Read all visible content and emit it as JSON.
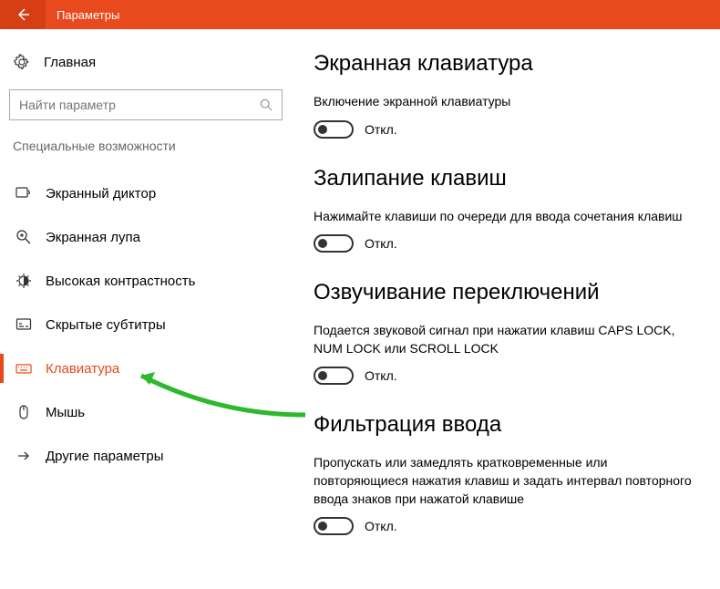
{
  "header": {
    "title": "Параметры"
  },
  "sidebar": {
    "home": "Главная",
    "search_placeholder": "Найти параметр",
    "section": "Специальные возможности",
    "items": [
      {
        "label": "Экранный диктор"
      },
      {
        "label": "Экранная лупа"
      },
      {
        "label": "Высокая контрастность"
      },
      {
        "label": "Скрытые субтитры"
      },
      {
        "label": "Клавиатура"
      },
      {
        "label": "Мышь"
      },
      {
        "label": "Другие параметры"
      }
    ]
  },
  "main": {
    "sections": [
      {
        "title": "Экранная клавиатура",
        "desc": "Включение экранной клавиатуры",
        "state": "Откл."
      },
      {
        "title": "Залипание клавиш",
        "desc": "Нажимайте клавиши по очереди для ввода сочетания клавиш",
        "state": "Откл."
      },
      {
        "title": "Озвучивание переключений",
        "desc": "Подается звуковой сигнал при нажатии клавиш CAPS LOCK, NUM LOCK или SCROLL LOCK",
        "state": "Откл."
      },
      {
        "title": "Фильтрация ввода",
        "desc": "Пропускать или замедлять кратковременные или повторяющиеся нажатия клавиш и задать интервал повторного ввода знаков при нажатой клавише",
        "state": "Откл."
      }
    ]
  }
}
